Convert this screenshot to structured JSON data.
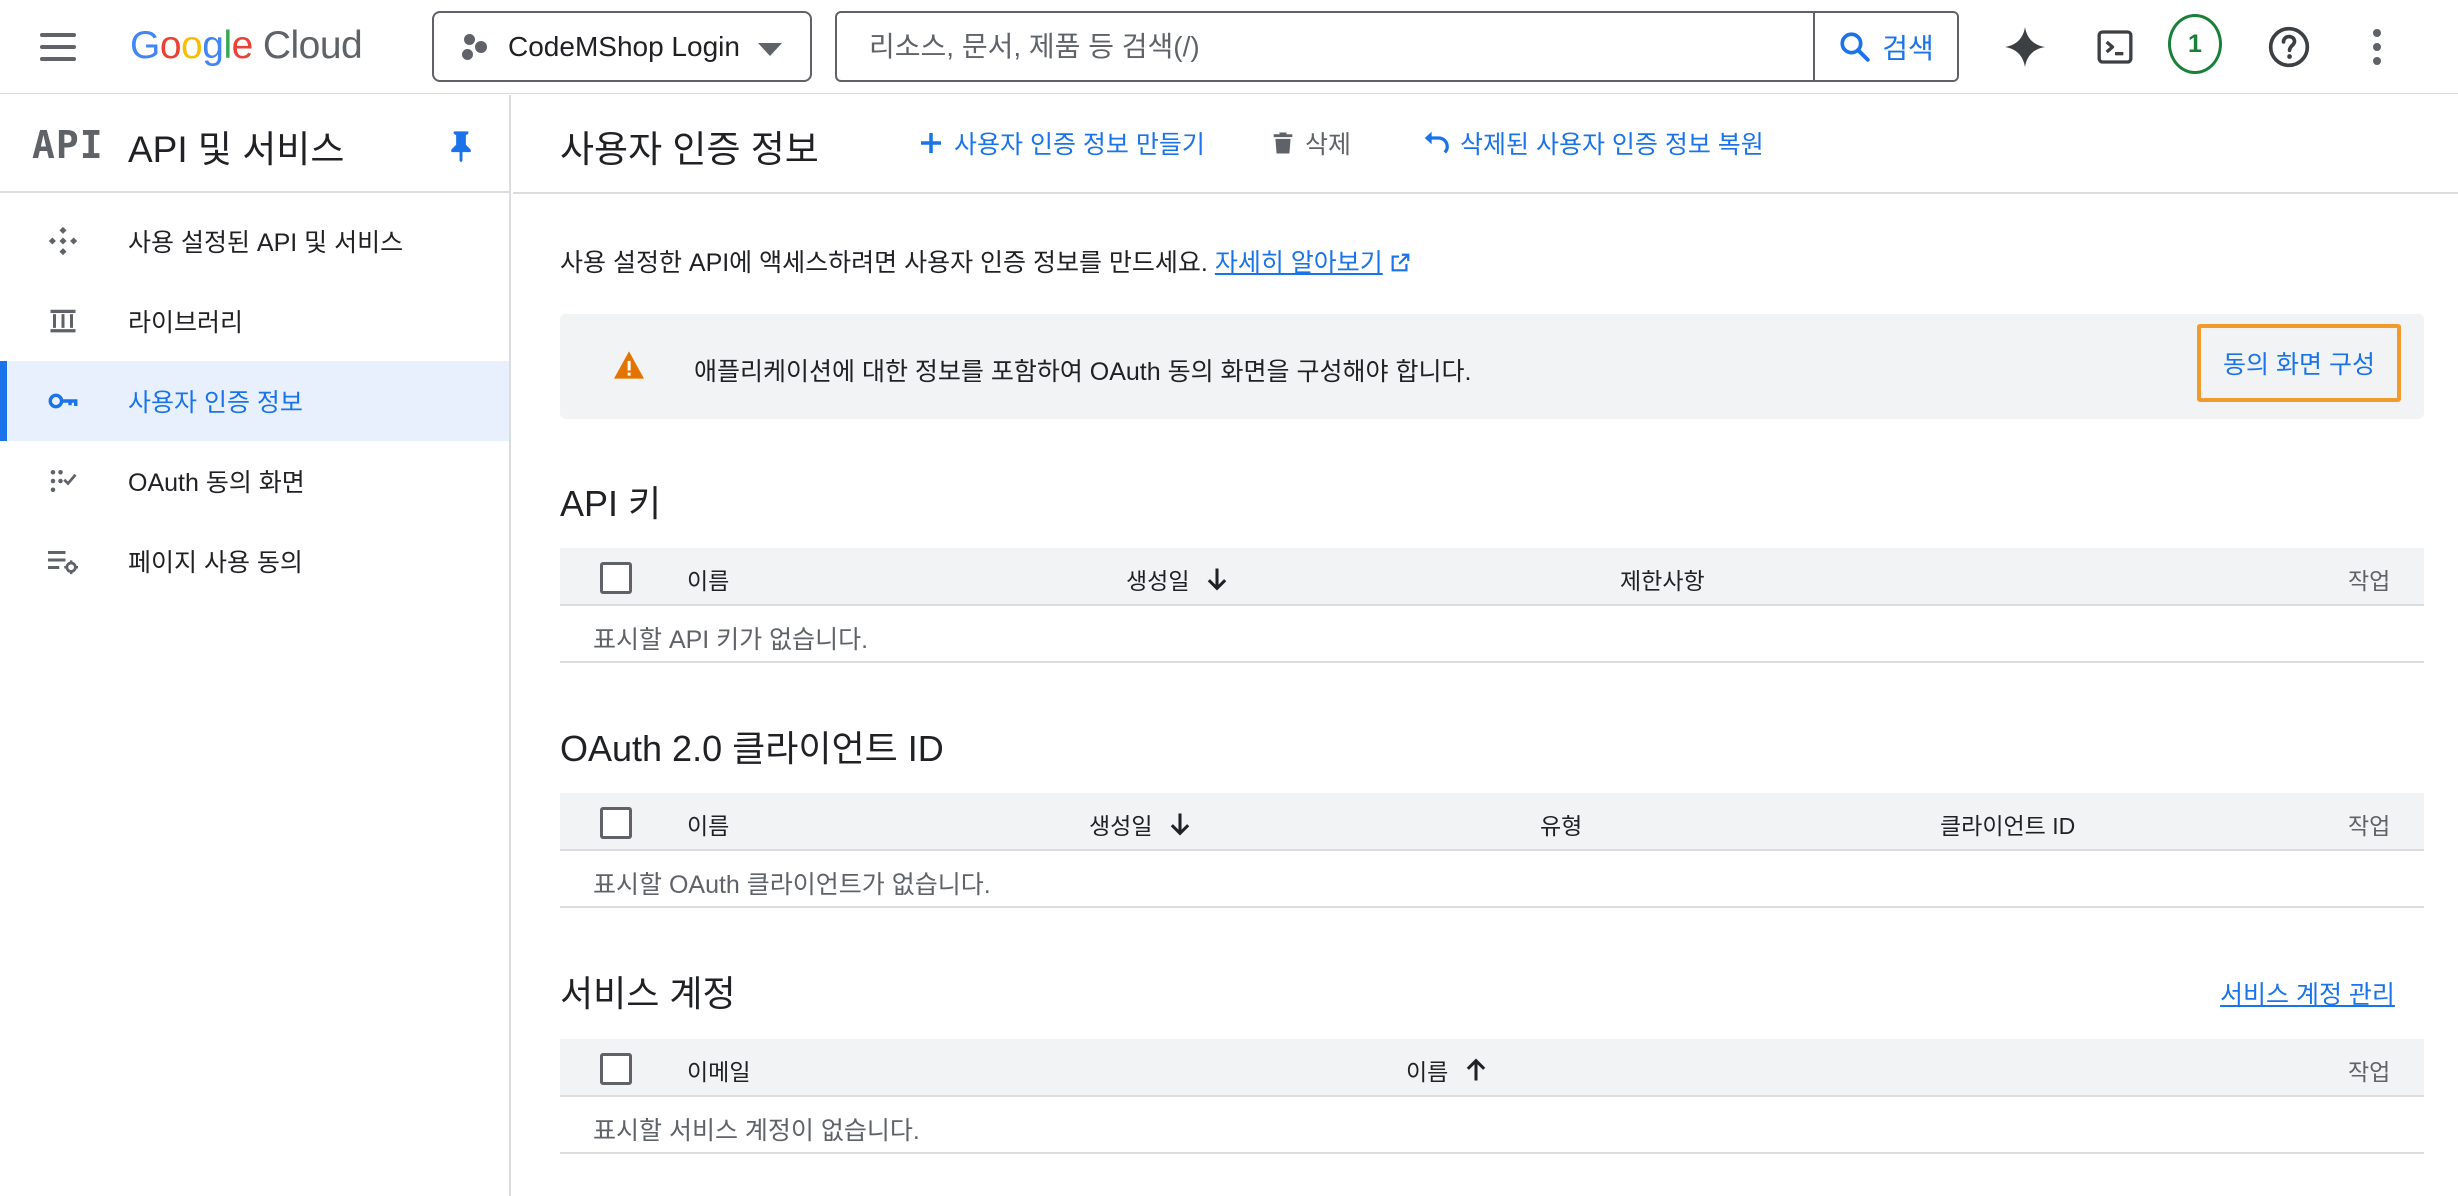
{
  "header": {
    "brand_letters": [
      "G",
      "o",
      "o",
      "g",
      "l",
      "e"
    ],
    "brand_suffix": "Cloud",
    "project": "CodeMShop Login",
    "search_placeholder": "리소스, 문서, 제품 등 검색(/)",
    "search_button": "검색",
    "notification_count": "1",
    "icons": [
      "menu-icon",
      "project-icon",
      "search-icon",
      "gemini-icon",
      "cloud-shell-icon",
      "help-icon",
      "more-vert-icon"
    ]
  },
  "sidebar": {
    "logo": "API",
    "title": "API 및 서비스",
    "items": [
      {
        "label": "사용 설정된 API 및 서비스",
        "icon": "enabled-apis-icon",
        "active": false
      },
      {
        "label": "라이브러리",
        "icon": "library-icon",
        "active": false
      },
      {
        "label": "사용자 인증 정보",
        "icon": "key-icon",
        "active": true
      },
      {
        "label": "OAuth 동의 화면",
        "icon": "oauth-consent-icon",
        "active": false
      },
      {
        "label": "페이지 사용 동의",
        "icon": "page-usage-icon",
        "active": false
      }
    ]
  },
  "main": {
    "title": "사용자 인증 정보",
    "actions": {
      "create": "사용자 인증 정보 만들기",
      "delete": "삭제",
      "restore": "삭제된 사용자 인증 정보 복원"
    },
    "intro_text": "사용 설정한 API에 액세스하려면 사용자 인증 정보를 만드세요.",
    "learn_more": "자세히 알아보기",
    "banner": {
      "text": "애플리케이션에 대한 정보를 포함하여 OAuth 동의 화면을 구성해야 합니다.",
      "button": "동의 화면 구성"
    },
    "api_keys": {
      "title": "API 키",
      "columns": {
        "name": "이름",
        "created": "생성일",
        "restrictions": "제한사항",
        "actions": "작업"
      },
      "empty": "표시할 API 키가 없습니다."
    },
    "oauth_clients": {
      "title": "OAuth 2.0 클라이언트 ID",
      "columns": {
        "name": "이름",
        "created": "생성일",
        "type": "유형",
        "client_id": "클라이언트 ID",
        "actions": "작업"
      },
      "empty": "표시할 OAuth 클라이언트가 없습니다."
    },
    "service_accounts": {
      "title": "서비스 계정",
      "manage_link": "서비스 계정 관리",
      "columns": {
        "email": "이메일",
        "name": "이름",
        "actions": "작업"
      },
      "empty": "표시할 서비스 계정이 없습니다."
    }
  },
  "colors": {
    "accent": "#1a73e8",
    "warning": "#e37400",
    "highlight_border": "#f09b2c",
    "active_bg": "#e8f0fe",
    "notif": "#188038"
  }
}
